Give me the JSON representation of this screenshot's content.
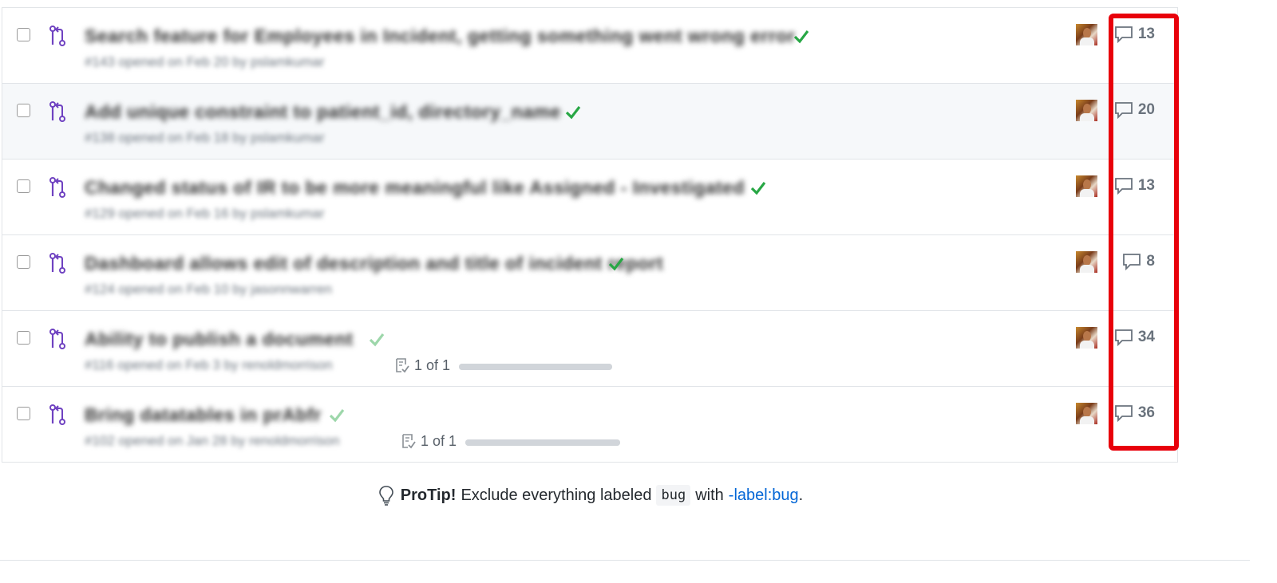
{
  "pull_requests": [
    {
      "title": "Search feature for Employees in Incident, getting something went wrong error",
      "meta": "#143 opened on Feb 20 by pslamkumar",
      "comments": "13"
    },
    {
      "title": "Add unique constraint to patient_id, directory_name",
      "meta": "#138 opened on Feb 18 by pslamkumar",
      "comments": "20"
    },
    {
      "title": "Changed status of IR to be more meaningful like Assigned - Investigated",
      "meta": "#129 opened on Feb 16 by pslamkumar",
      "comments": "13"
    },
    {
      "title": "Dashboard allows edit of description and title of incident report",
      "meta": "#124 opened on Feb 10 by jasonnwarren",
      "comments": "8"
    },
    {
      "title": "Ability to publish a document",
      "meta": "#116 opened on Feb 3 by renoldmorrison",
      "comments": "34",
      "tasks": "1 of 1",
      "tasks_done_fraction": 1
    },
    {
      "title": "Bring datatables in prAbfr",
      "meta": "#102 opened on Jan 28 by renoldmorrison",
      "comments": "36",
      "tasks": "1 of 1",
      "tasks_done_fraction": 1
    }
  ],
  "protip": {
    "label": "ProTip!",
    "text_before": "Exclude everything labeled",
    "code": "bug",
    "text_middle": "with",
    "link": "-label:bug",
    "text_after": "."
  },
  "colors": {
    "pr_icon": "#6f42c1",
    "check": "#28a745",
    "highlight": "#e8000b",
    "link": "#0366d6"
  },
  "icons": [
    "git-pull-request-icon",
    "check-icon",
    "comment-icon",
    "tasklist-icon",
    "lightbulb-icon"
  ]
}
